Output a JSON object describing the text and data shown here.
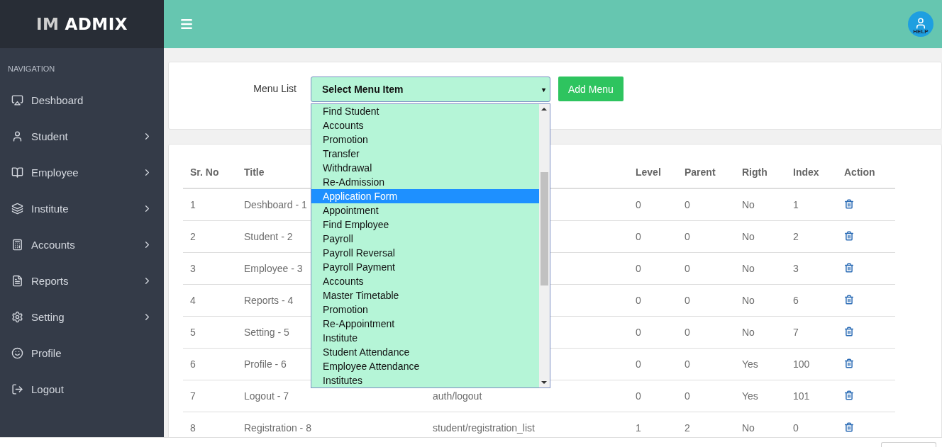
{
  "brand": {
    "first": "IM",
    "second": "ADMIX"
  },
  "topbar": {
    "help_label": "HELP"
  },
  "sidebar": {
    "heading": "NAVIGATION",
    "items": [
      {
        "label": "Deshboard",
        "has_submenu": false
      },
      {
        "label": "Student",
        "has_submenu": true
      },
      {
        "label": "Employee",
        "has_submenu": true
      },
      {
        "label": "Institute",
        "has_submenu": true
      },
      {
        "label": "Accounts",
        "has_submenu": true
      },
      {
        "label": "Reports",
        "has_submenu": true
      },
      {
        "label": "Setting",
        "has_submenu": true
      },
      {
        "label": "Profile",
        "has_submenu": false
      },
      {
        "label": "Logout",
        "has_submenu": false
      }
    ]
  },
  "menu_form": {
    "label": "Menu List",
    "select": {
      "value": "Select Menu Item",
      "caret": "▾",
      "expanded": true,
      "options": [
        {
          "label": "Find Student",
          "selected": false
        },
        {
          "label": "Accounts",
          "selected": false
        },
        {
          "label": "Promotion",
          "selected": false
        },
        {
          "label": "Transfer",
          "selected": false
        },
        {
          "label": "Withdrawal",
          "selected": false
        },
        {
          "label": "Re-Admission",
          "selected": false
        },
        {
          "label": "Application Form",
          "selected": true
        },
        {
          "label": "Appointment",
          "selected": false
        },
        {
          "label": "Find Employee",
          "selected": false
        },
        {
          "label": "Payroll",
          "selected": false
        },
        {
          "label": "Payroll Reversal",
          "selected": false
        },
        {
          "label": "Payroll Payment",
          "selected": false
        },
        {
          "label": "Accounts",
          "selected": false
        },
        {
          "label": "Master Timetable",
          "selected": false
        },
        {
          "label": "Promotion",
          "selected": false
        },
        {
          "label": "Re-Appointment",
          "selected": false
        },
        {
          "label": "Institute",
          "selected": false
        },
        {
          "label": "Student Attendance",
          "selected": false
        },
        {
          "label": "Employee Attendance",
          "selected": false
        },
        {
          "label": "Institutes",
          "selected": false
        }
      ]
    },
    "button": "Add Menu"
  },
  "table": {
    "columns": [
      "Sr. No",
      "Title",
      "Level",
      "Parent",
      "Rigth",
      "Index",
      "Action"
    ],
    "rows": [
      {
        "sr": "1",
        "title": "Deshboard - 1",
        "level": "0",
        "parent": "0",
        "right": "No",
        "index": "1"
      },
      {
        "sr": "2",
        "title": "Student - 2",
        "level": "0",
        "parent": "0",
        "right": "No",
        "index": "2"
      },
      {
        "sr": "3",
        "title": "Employee - 3",
        "level": "0",
        "parent": "0",
        "right": "No",
        "index": "3"
      },
      {
        "sr": "4",
        "title": "Reports - 4",
        "level": "0",
        "parent": "0",
        "right": "No",
        "index": "6"
      },
      {
        "sr": "5",
        "title": "Setting - 5",
        "level": "0",
        "parent": "0",
        "right": "No",
        "index": "7"
      },
      {
        "sr": "6",
        "title": "Profile - 6",
        "level": "0",
        "parent": "0",
        "right": "Yes",
        "index": "100"
      },
      {
        "sr": "7",
        "title": "Logout - 7",
        "column_3": "auth/logout",
        "level": "0",
        "parent": "0",
        "right": "Yes",
        "index": "101"
      },
      {
        "sr": "8",
        "title": "Registration - 8",
        "column_3": "student/registration_list",
        "level": "1",
        "parent": "2",
        "right": "No",
        "index": "0"
      }
    ]
  }
}
